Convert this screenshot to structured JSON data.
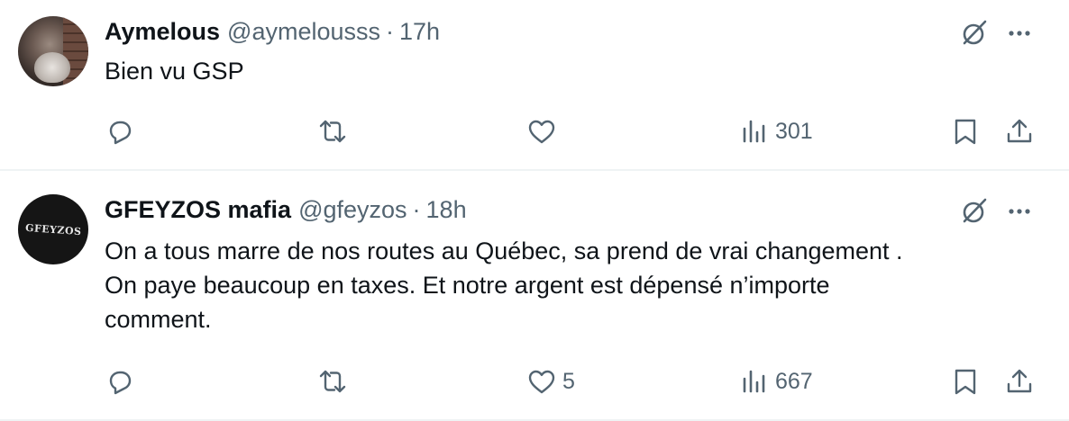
{
  "tweets": [
    {
      "author_name": "Aymelous",
      "handle": "@aymelousss",
      "separator": "·",
      "time": "17h",
      "text_lines": [
        "Bien vu GSP"
      ],
      "likes": "",
      "views": "301"
    },
    {
      "author_name": "GFEYZOS mafia",
      "handle": "@gfeyzos",
      "separator": "·",
      "time": "18h",
      "avatar_text": "GFEYZOS",
      "text_lines": [
        "On a tous marre de nos routes au Québec, sa prend de vrai changement .",
        "On paye beaucoup en taxes. Et notre argent est dépensé n’importe",
        "comment."
      ],
      "likes": "5",
      "views": "667"
    }
  ],
  "icons": {
    "reply": "reply-icon",
    "retweet": "retweet-icon",
    "like": "heart-icon",
    "views": "views-icon",
    "bookmark": "bookmark-icon",
    "share": "share-icon",
    "grok": "grok-icon",
    "more": "more-icon"
  },
  "colors": {
    "text": "#0f1419",
    "secondary": "#536471",
    "divider": "#eff3f4"
  }
}
